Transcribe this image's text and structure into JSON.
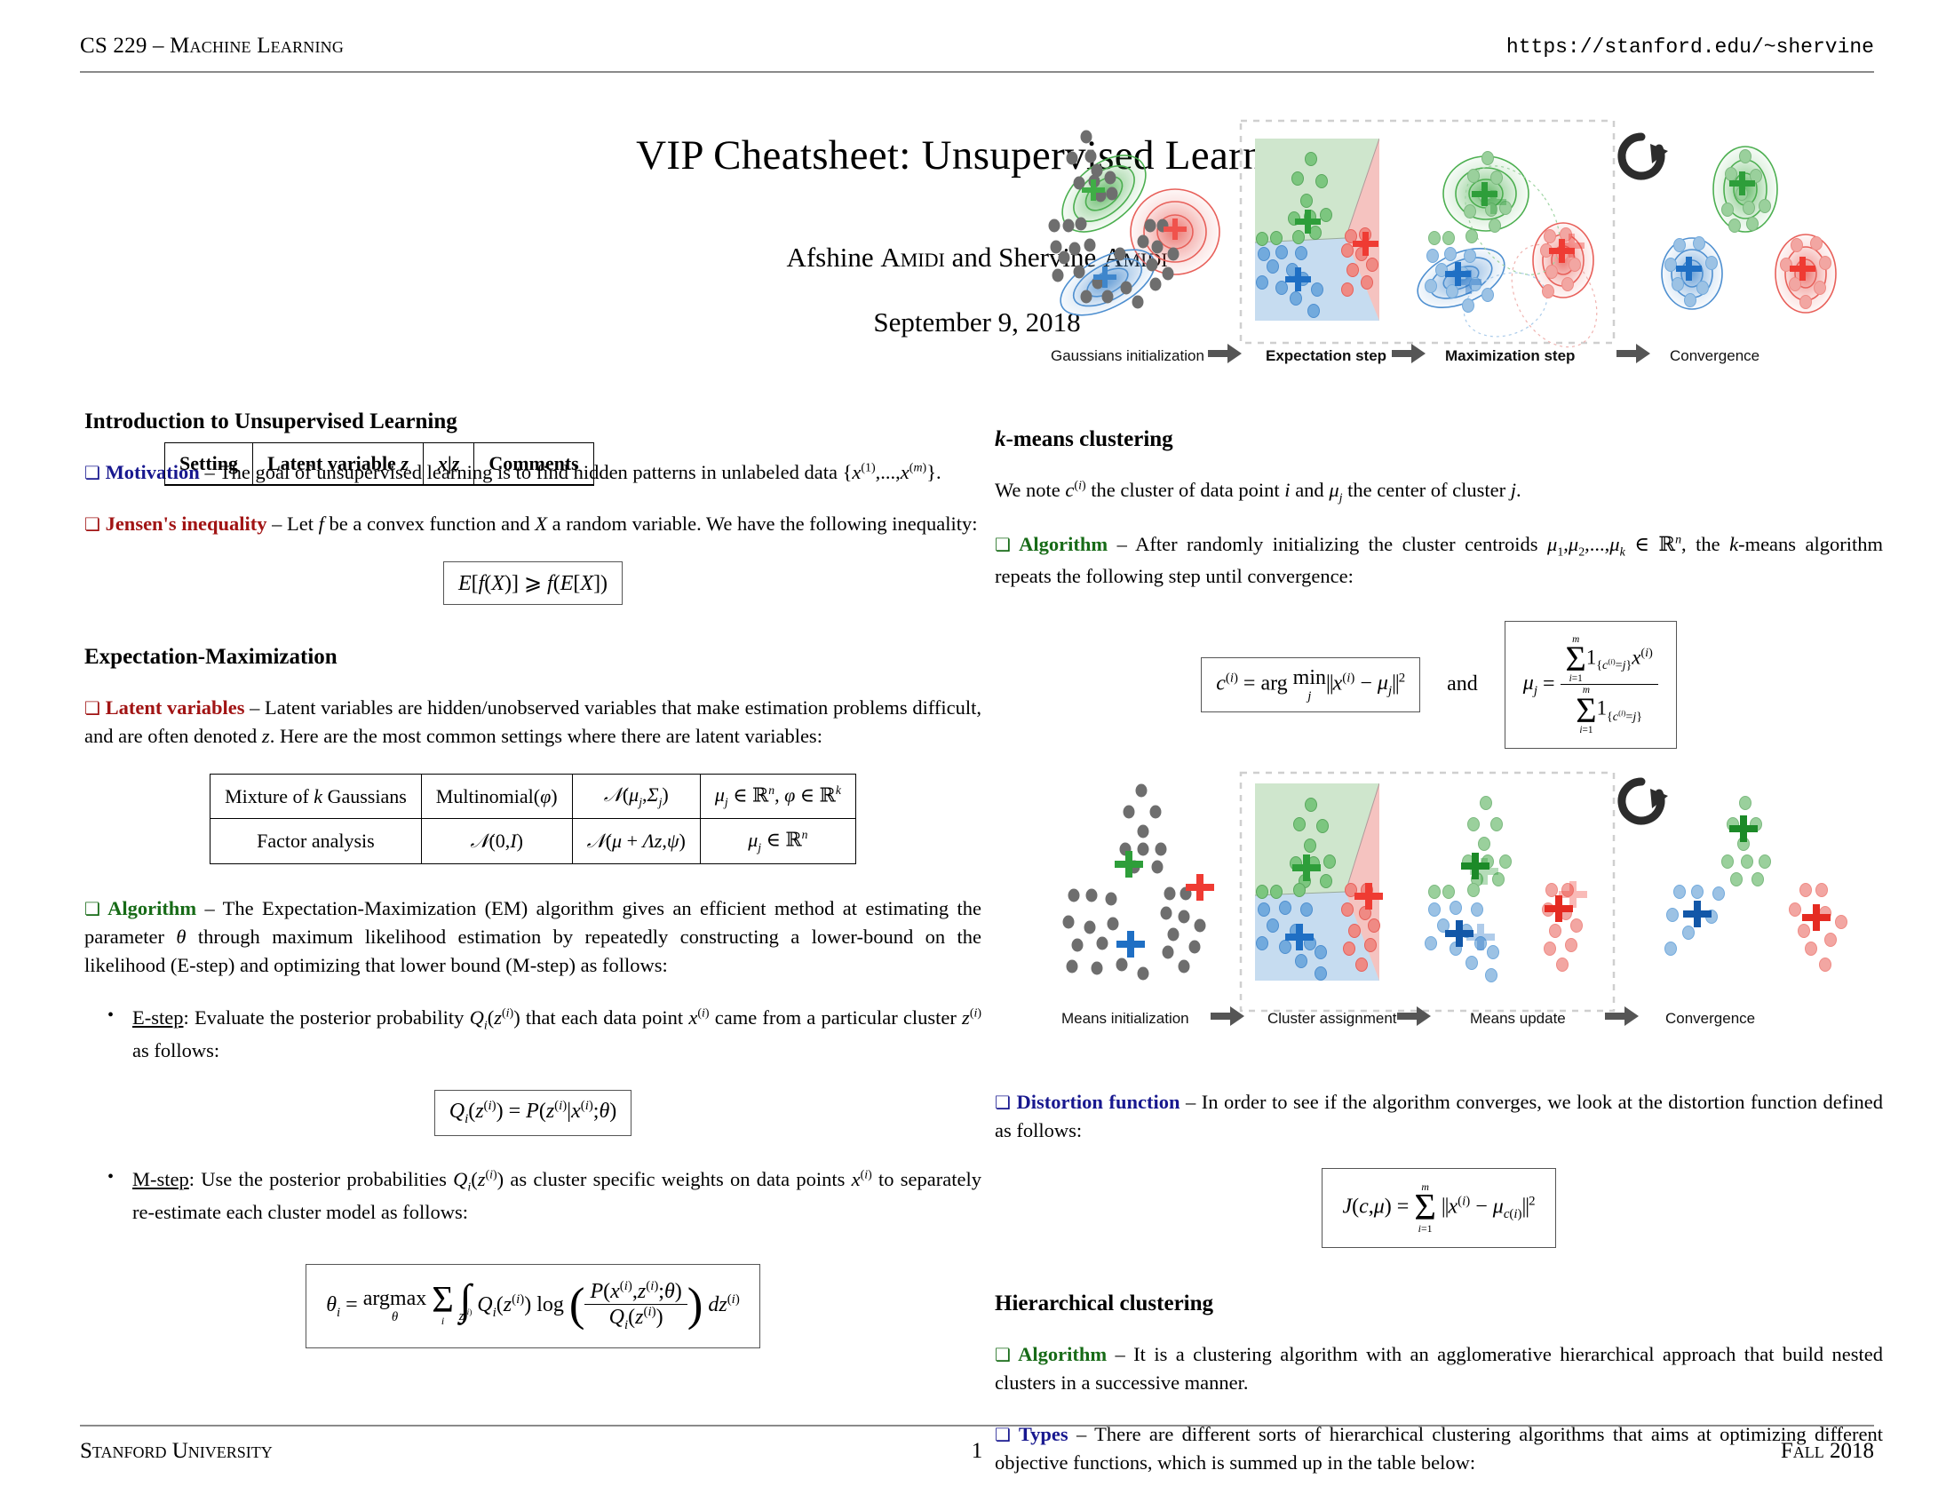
{
  "header": {
    "course": "CS 229 – Machine Learning",
    "url": "https://stanford.edu/~shervine"
  },
  "title": {
    "main": "VIP Cheatsheet: Unsupervised Learning",
    "authors": "Afshine Amidi and Shervine Amidi",
    "date": "September 9, 2018"
  },
  "colors": {
    "label_blue": "#18188f",
    "label_red": "#a11414",
    "label_green": "#176b17",
    "cluster_green": "#4caf50",
    "cluster_red": "#e8605a",
    "cluster_blue": "#4e8fd0",
    "point_gray": "#6e6e6e"
  },
  "left_column": {
    "section1_heading": "Introduction to Unsupervised Learning",
    "motivation": {
      "marker": "❏",
      "label": "Motivation",
      "dash": " – ",
      "text_before": "The goal of unsupervised learning is to find hidden patterns in unlabeled data ",
      "math_inline": "{x(1),...,x(m)}."
    },
    "jensen": {
      "marker": "❏",
      "label": "Jensen's inequality",
      "dash": " – ",
      "text": "Let f be a convex function and X a random variable. We have the following inequality:",
      "formula": "E[f(X)] ⩾ f(E[X])"
    },
    "section2_heading": "Expectation-Maximization",
    "latent": {
      "marker": "❏",
      "label": "Latent variables",
      "dash": " – ",
      "text": "Latent variables are hidden/unobserved variables that make estimation problems difficult, and are often denoted z. Here are the most common settings where there are latent variables:"
    },
    "table": {
      "headers": [
        "Setting",
        "Latent variable z",
        "x|z",
        "Comments"
      ],
      "rows": [
        [
          "Mixture of k Gaussians",
          "Multinomial(φ)",
          "N(μj,Σj)",
          "μj ∈ ℝn, φ ∈ ℝk"
        ],
        [
          "Factor analysis",
          "N(0,I)",
          "N(μ + Λz,ψ)",
          "μj ∈ ℝn"
        ]
      ]
    },
    "em_algorithm": {
      "marker": "❏",
      "label": "Algorithm",
      "dash": " – ",
      "text": "The Expectation-Maximization (EM) algorithm gives an efficient method at estimating the parameter θ through maximum likelihood estimation by repeatedly constructing a lower-bound on the likelihood (E-step) and optimizing that lower bound (M-step) as follows:"
    },
    "estep": {
      "name": "E-step",
      "colon": ": ",
      "text": "Evaluate the posterior probability Qi(z(i)) that each data point x(i) came from a particular cluster z(i) as follows:",
      "formula": "Qi(z(i)) = P(z(i)|x(i);θ)"
    },
    "mstep": {
      "name": "M-step",
      "colon": ": ",
      "text": "Use the posterior probabilities Qi(z(i)) as cluster specific weights on data points x(i) to separately re-estimate each cluster model as follows:",
      "formula": "θi = argmaxθ Σi ∫z(i) Qi(z(i)) log( P(x(i),z(i);θ) / Qi(z(i)) ) dz(i)"
    }
  },
  "right_column": {
    "kmeans_heading": "k-means clustering",
    "kmeans_note": "We note c(i) the cluster of data point i and μj the center of cluster j.",
    "kmeans_algorithm": {
      "marker": "❏",
      "label": "Algorithm",
      "dash": " – ",
      "text": "After randomly initializing the cluster centroids μ1,μ2,...,μk ∈ ℝn, the k-means algorithm repeats the following step until convergence:"
    },
    "kmeans_formula_left": "c(i) = arg minj ||x(i) − μj||²",
    "kmeans_and": "and",
    "kmeans_formula_right": "μj = Σi=1..m 1{c(i)=j} x(i) / Σi=1..m 1{c(i)=j}",
    "distortion": {
      "marker": "❏",
      "label": "Distortion function",
      "dash": " – ",
      "text": "In order to see if the algorithm converges, we look at the distortion function defined as follows:",
      "formula": "J(c,μ) = Σi=1..m ||x(i) − μc(i)||²"
    },
    "hier_heading": "Hierarchical clustering",
    "hier_algorithm": {
      "marker": "❏",
      "label": "Algorithm",
      "dash": " – ",
      "text": "It is a clustering algorithm with an agglomerative hierarchical approach that build nested clusters in a successive manner."
    },
    "hier_types": {
      "marker": "❏",
      "label": "Types",
      "dash": " – ",
      "text": "There are different sorts of hierarchical clustering algorithms that aims at optimizing different objective functions, which is summed up in the table below:"
    }
  },
  "figure_em": {
    "name": "gaussian-mixture-em-diagram",
    "steps": [
      {
        "label": "Gaussians initialization",
        "bold_prefix": ""
      },
      {
        "label": "Expectation step",
        "bold_prefix": "E"
      },
      {
        "label": "Maximization step",
        "bold_prefix": "M"
      },
      {
        "label": "Convergence",
        "bold_prefix": ""
      }
    ],
    "arrow_glyph": "➡",
    "loop_icon": "refresh-loop-icon"
  },
  "figure_kmeans": {
    "name": "kmeans-steps-diagram",
    "steps": [
      {
        "label": "Means initialization"
      },
      {
        "label": "Cluster assignment"
      },
      {
        "label": "Means update"
      },
      {
        "label": "Convergence"
      }
    ],
    "arrow_glyph": "➡",
    "loop_icon": "refresh-loop-icon"
  },
  "footer": {
    "left": "Stanford University",
    "center": "1",
    "right": "Fall 2018"
  }
}
